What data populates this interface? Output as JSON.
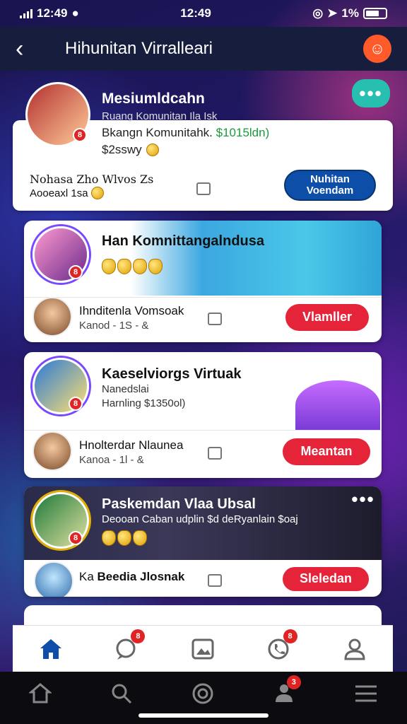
{
  "status_bar": {
    "carrier_time": "12:49",
    "time": "12:49",
    "battery": "1%"
  },
  "header": {
    "title": "Hihunitan Virralleari"
  },
  "top_card": {
    "title": "Mesiumldcahn",
    "subtitle": "Ruang Komunitan Ila Isk",
    "line1_prefix": "Bkangn Komunitahk.",
    "line1_value": "$1015ldn)",
    "line2": "$2sswy",
    "left_line1": "Nohasa Zho Wlvos Zs",
    "left_line2": "Aooeaxl 1sa",
    "button_label": "Nuhitan Voendam"
  },
  "cards": [
    {
      "title": "Han Komnittangalndusa",
      "row_name": "Ihnditenla Vomsoak",
      "row_meta": "Kanod - 1S - &",
      "button": "Vlamller"
    },
    {
      "title": "Kaeselviorgs Virtuak",
      "meta1": "Nanedslai",
      "meta2": "Harnling  $1350ol)",
      "row_name": "Hnolterdar Nlaunea",
      "row_meta": "Kanoa - 1l - &",
      "button": "Meantan"
    },
    {
      "title": "Paskemdan Vlaa Ubsal",
      "meta1": "Deooan Caban udplin  $d  deRyanlain  $oaj",
      "row_name": "Beedia Jlosnak",
      "row_prefix": "Ka",
      "button": "Sleledan"
    }
  ],
  "tabs": [
    {
      "name": "home",
      "badge": ""
    },
    {
      "name": "chat",
      "badge": "8"
    },
    {
      "name": "gallery",
      "badge": ""
    },
    {
      "name": "calls",
      "badge": "8"
    },
    {
      "name": "profile",
      "badge": ""
    }
  ],
  "colors": {
    "accent_red": "#e5243a",
    "accent_blue": "#0d4ea8",
    "header_bg": "#171d3d"
  }
}
